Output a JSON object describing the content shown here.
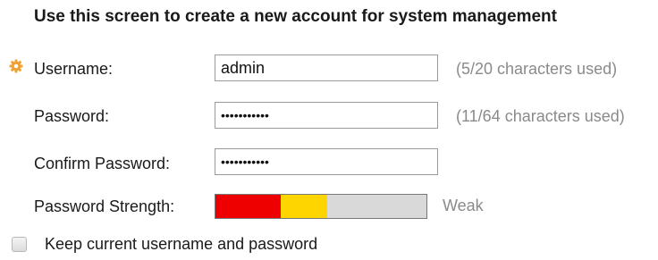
{
  "heading": "Use this screen to create a new account for system management",
  "icons": {
    "required": "required-field-gear-icon"
  },
  "colors": {
    "required_icon": "#f0a030",
    "strength_weak_red": "#ee0000",
    "strength_weak_yellow": "#ffd500",
    "strength_empty": "#d9d9d9",
    "hint_text": "#8a8a8a"
  },
  "form": {
    "username": {
      "label": "Username:",
      "value": "admin",
      "hint": "(5/20 characters used)"
    },
    "password": {
      "label": "Password:",
      "value": "•••••••••••",
      "hint": "(11/64 characters used)"
    },
    "confirm_password": {
      "label": "Confirm Password:",
      "value": "•••••••••••"
    },
    "strength": {
      "label": "Password Strength:",
      "text": "Weak",
      "segments": [
        {
          "color": "#ee0000",
          "fraction": 0.31
        },
        {
          "color": "#ffd500",
          "fraction": 0.22
        }
      ]
    },
    "keep_current": {
      "label": "Keep current username and password",
      "checked": false
    }
  }
}
